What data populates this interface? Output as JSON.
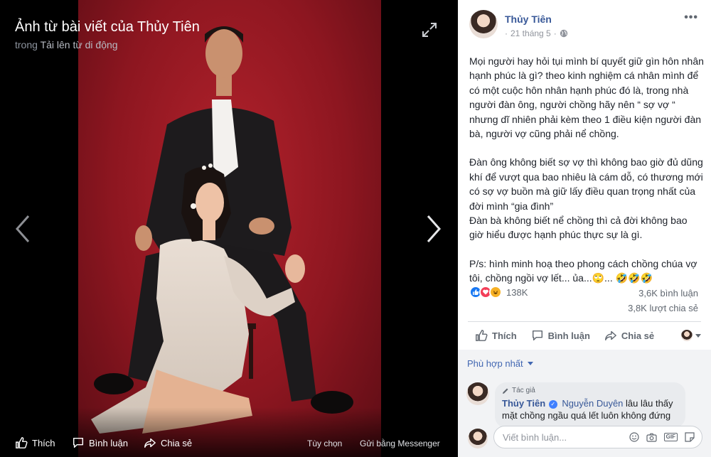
{
  "viewer": {
    "title": "Ảnh từ bài viết của Thủy Tiên",
    "subtitle_prefix": "trong",
    "subtitle_album": "Tải lên từ di động",
    "actions": {
      "like": "Thích",
      "comment": "Bình luận",
      "share": "Chia sẻ",
      "options": "Tùy chọn",
      "messenger": "Gửi bằng Messenger"
    }
  },
  "post": {
    "author": "Thủy Tiên",
    "date": "21 tháng 5",
    "privacy_icon": "globe-icon",
    "paragraphs": [
      "Mọi người hay hỏi tụi mình bí quyết giữ gìn hôn nhân hạnh phúc là gì? theo kinh nghiệm cá nhân mình để có một cuộc hôn nhân hạnh phúc đó là, trong nhà người đàn ông, người chồng hãy nên “ sợ vợ “ nhưng dĩ nhiên phải kèm theo 1 điều kiện người đàn bà, người vợ cũng phải nể chồng.",
      "Đàn ông không biết sợ vợ thì không bao giờ đủ dũng khí để vượt qua bao nhiêu là cám dỗ, có thương mới có sợ vợ buồn mà giữ lấy điều quan trọng nhất của đời mình “gia đình”",
      "Đàn bà không biết nể chồng thì cả đời không bao giờ hiểu được hạnh phúc thực sự là gì.",
      "P/s: hình minh hoạ theo phong cách chồng chúa vợ tôi, chồng ngồi vợ lết... ủa...🙄... 🤣🤣🤣"
    ],
    "reactions_count": "138K",
    "comments_count": "3,6K bình luận",
    "shares_count": "3,8K lượt chia sẻ",
    "actions": {
      "like": "Thích",
      "comment": "Bình luận",
      "share": "Chia sẻ"
    },
    "sort_label": "Phù hợp nhất"
  },
  "comment": {
    "tag": "Tác giả",
    "author": "Thủy Tiên",
    "mention": "Nguyễn Duyên",
    "text": "lâu lâu thấy mặt chồng ngầu quá lết luôn không đứng"
  },
  "reply": {
    "placeholder": "Viết bình luận..."
  },
  "colors": {
    "link_blue": "#385898",
    "like_blue": "#1877f2",
    "love_red": "#f33e58",
    "haha_yellow": "#f7b125",
    "backdrop_red": "#8d1620"
  }
}
